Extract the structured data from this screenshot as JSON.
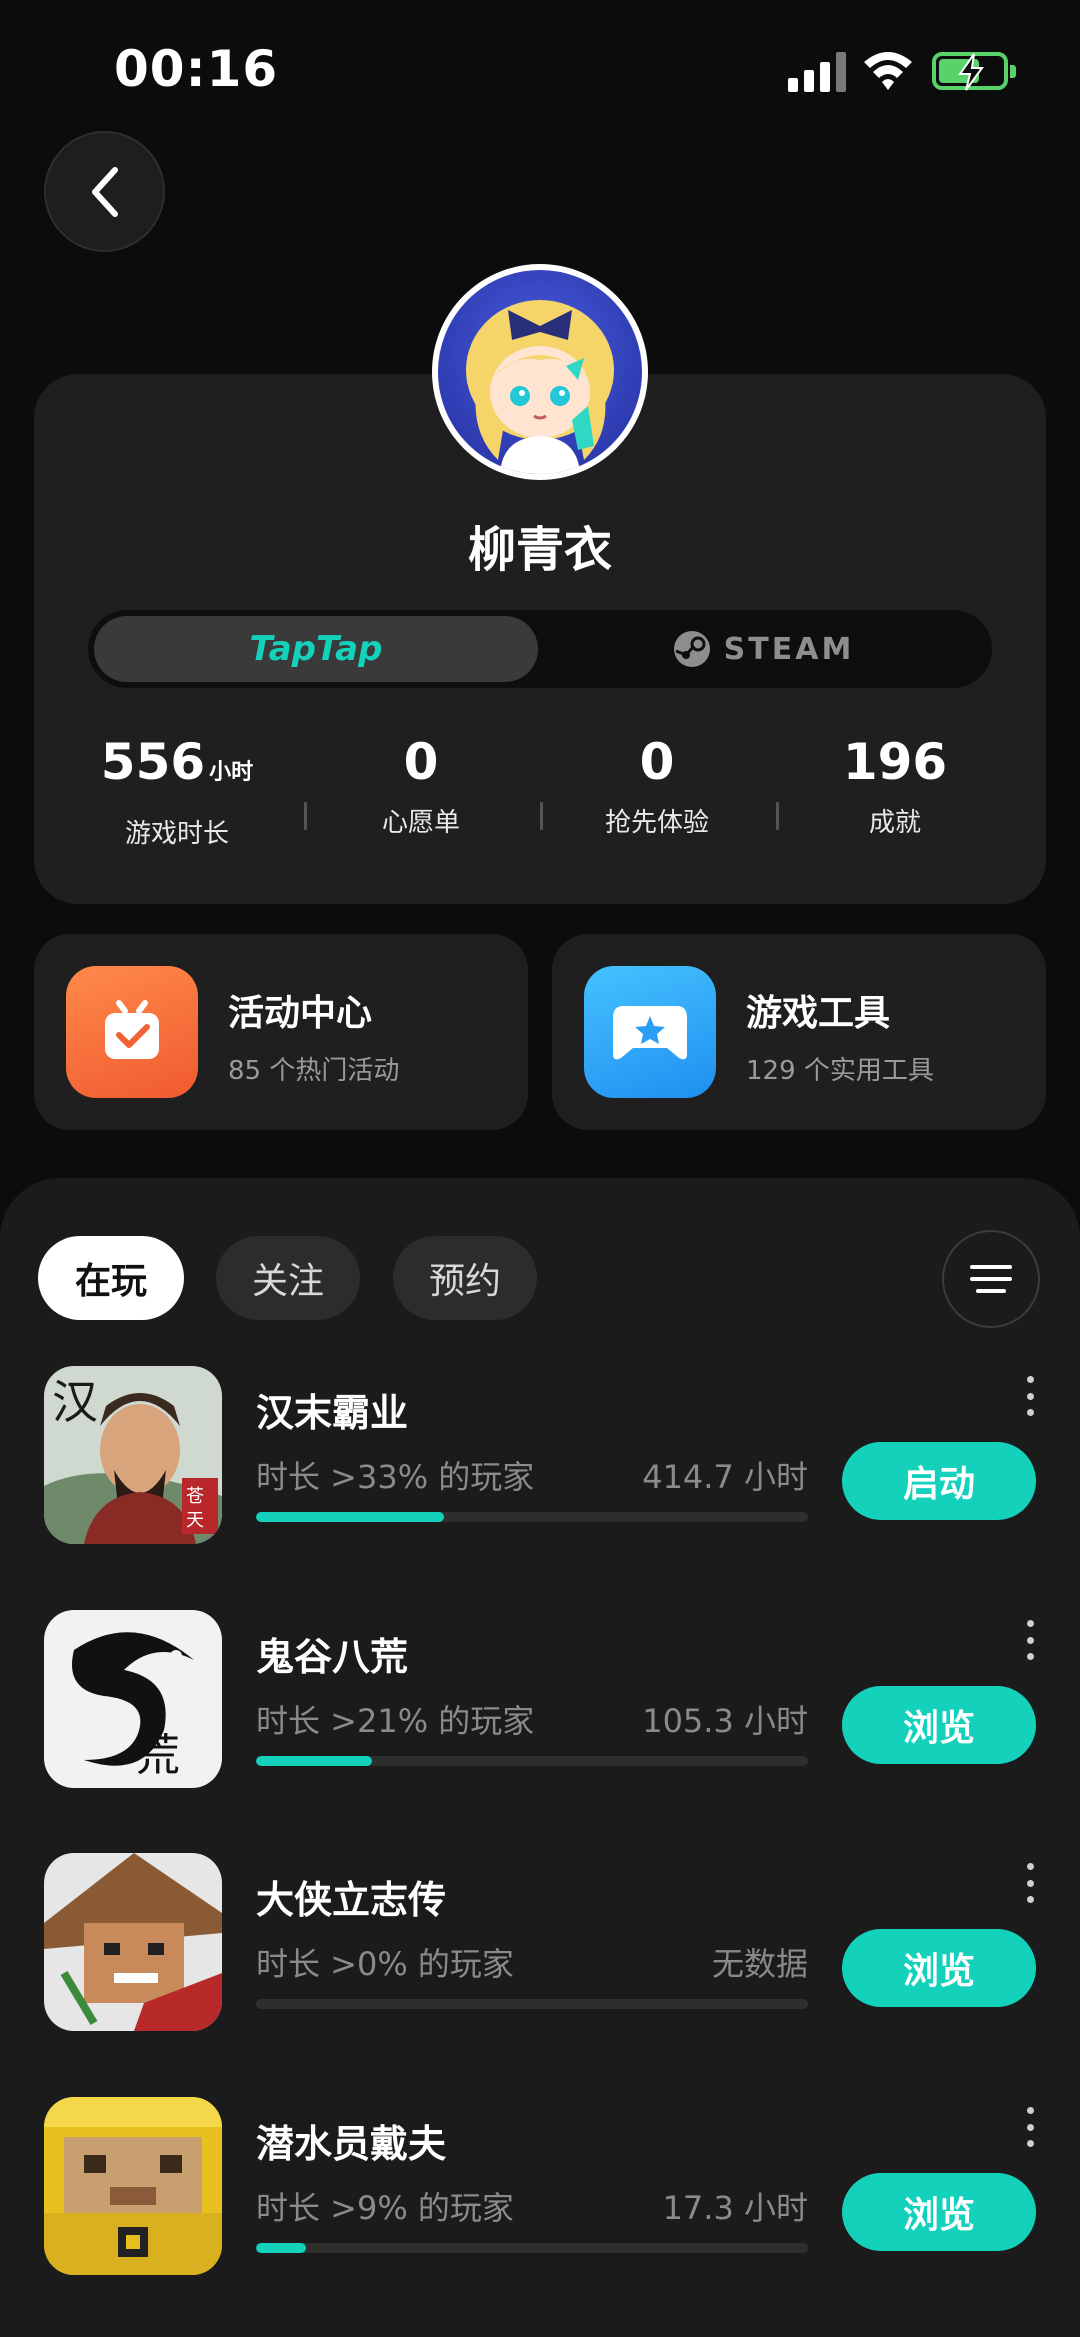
{
  "status_bar": {
    "time": "00:16"
  },
  "profile": {
    "username": "柳青衣",
    "platform_tabs": [
      "TapTap",
      "STEAM"
    ],
    "active_platform": "TapTap",
    "stats": [
      {
        "value": "556",
        "unit": "小时",
        "label": "游戏时长"
      },
      {
        "value": "0",
        "unit": "",
        "label": "心愿单"
      },
      {
        "value": "0",
        "unit": "",
        "label": "抢先体验"
      },
      {
        "value": "196",
        "unit": "",
        "label": "成就"
      }
    ]
  },
  "features": [
    {
      "title": "活动中心",
      "subtitle": "85 个热门活动",
      "icon": "calendar-check-icon",
      "color": "#f56a3c"
    },
    {
      "title": "游戏工具",
      "subtitle": "129 个实用工具",
      "icon": "gamepad-icon",
      "color": "#2fa9f4"
    }
  ],
  "list": {
    "tabs": [
      "在玩",
      "关注",
      "预约"
    ],
    "active_tab": "在玩",
    "games": [
      {
        "name": "汉末霸业",
        "percentile": "时长 >33% 的玩家",
        "hours": "414.7 小时",
        "progress": 0.34,
        "action": "启动"
      },
      {
        "name": "鬼谷八荒",
        "percentile": "时长 >21% 的玩家",
        "hours": "105.3 小时",
        "progress": 0.21,
        "action": "浏览"
      },
      {
        "name": "大侠立志传",
        "percentile": "时长 >0% 的玩家",
        "hours": "无数据",
        "progress": 0.0,
        "action": "浏览"
      },
      {
        "name": "潜水员戴夫",
        "percentile": "时长 >9% 的玩家",
        "hours": "17.3 小时",
        "progress": 0.09,
        "action": "浏览"
      }
    ]
  },
  "colors": {
    "accent": "#14d1bc",
    "background": "#0c0c0c",
    "card": "#1f1f1f"
  }
}
